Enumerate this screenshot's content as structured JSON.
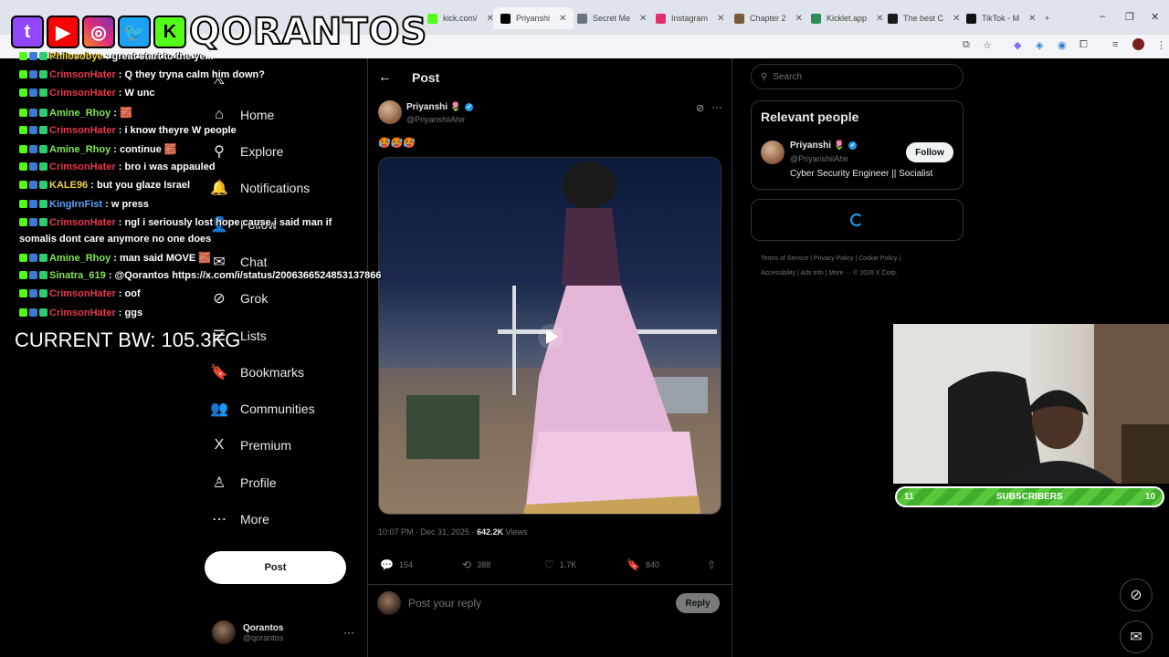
{
  "browser": {
    "tabs": [
      {
        "label": "kick.com/",
        "color": "#53fc18"
      },
      {
        "label": "Priyanshi",
        "color": "#000000"
      },
      {
        "label": "Secret Me",
        "color": "#6b7280"
      },
      {
        "label": "Instagram",
        "color": "#e1306c"
      },
      {
        "label": "Chapter 2",
        "color": "#7a5c3a"
      },
      {
        "label": "Kicklet.app",
        "color": "#2e8b57"
      },
      {
        "label": "The best C",
        "color": "#1a1a1a"
      },
      {
        "label": "TikTok - M",
        "color": "#111111"
      }
    ],
    "new_tab": "+",
    "window_controls": [
      "–",
      "❐",
      "✕"
    ]
  },
  "overlay": {
    "logo_text": "QORANTOS",
    "logo_icons": [
      "twitch",
      "youtube",
      "instagram",
      "twitter",
      "kick"
    ],
    "bw_text": "CURRENT BW: 105.3KG"
  },
  "chat": [
    {
      "user": "Philosobye",
      "msg": "great start to the ye...",
      "color": "u-yellow"
    },
    {
      "user": "CrimsonHater",
      "msg": "Q they tryna calm him down?",
      "color": "u-red"
    },
    {
      "user": "CrimsonHater",
      "msg": "W unc",
      "color": "u-red"
    },
    {
      "user": "Amine_Rhoy",
      "msg": "🧱",
      "color": "u-green"
    },
    {
      "user": "CrimsonHater",
      "msg": "i know theyre W people",
      "color": "u-red"
    },
    {
      "user": "Amine_Rhoy",
      "msg": "continue 🧱",
      "color": "u-green"
    },
    {
      "user": "CrimsonHater",
      "msg": "bro i was appauled",
      "color": "u-red"
    },
    {
      "user": "KALE96",
      "msg": "but you glaze Israel",
      "color": "u-yellow"
    },
    {
      "user": "KingIrnFist",
      "msg": "w press",
      "color": "u-blue"
    },
    {
      "user": "CrimsonHater",
      "msg": "ngl i seriously lost hope cause i said man if",
      "msg2": "somalis dont care anymore no one does",
      "color": "u-red"
    },
    {
      "user": "Amine_Rhoy",
      "msg": "man said MOVE 🧱",
      "color": "u-green"
    },
    {
      "user": "Sinatra_619",
      "msg": "@Qorantos https://x.com/i/status/2006366524853137866",
      "color": "u-green"
    },
    {
      "user": "CrimsonHater",
      "msg": "oof",
      "color": "u-red"
    },
    {
      "user": "CrimsonHater",
      "msg": "ggs",
      "color": "u-red"
    }
  ],
  "sidebar": {
    "items": [
      {
        "label": "Home",
        "icon": "⌂",
        "name": "home"
      },
      {
        "label": "Explore",
        "icon": "⚲",
        "name": "explore"
      },
      {
        "label": "Notifications",
        "icon": "🔔",
        "name": "notifications"
      },
      {
        "label": "Follow",
        "icon": "👤",
        "name": "follow"
      },
      {
        "label": "Chat",
        "icon": "✉",
        "name": "chat"
      },
      {
        "label": "Grok",
        "icon": "⊘",
        "name": "grok"
      },
      {
        "label": "Lists",
        "icon": "☰",
        "name": "lists"
      },
      {
        "label": "Bookmarks",
        "icon": "🔖",
        "name": "bookmarks"
      },
      {
        "label": "Communities",
        "icon": "👥",
        "name": "communities"
      },
      {
        "label": "Premium",
        "icon": "X",
        "name": "premium"
      },
      {
        "label": "Profile",
        "icon": "♙",
        "name": "profile"
      },
      {
        "label": "More",
        "icon": "⋯",
        "name": "more"
      }
    ],
    "post_button": "Post",
    "account": {
      "name": "Qorantos",
      "handle": "@qorantos",
      "menu": "···"
    }
  },
  "post": {
    "back": "←",
    "title": "Post",
    "author_name": "Priyanshi 🌷",
    "author_handle": "@PriyanshiiAhir",
    "text": "🥵🥵🥵",
    "time": "10:07 PM · Dec 31, 2025 · ",
    "views_count": "642.2K",
    "views_label": " Views",
    "stats": {
      "replies": "154",
      "reposts": "388",
      "likes": "1.7K",
      "bookmarks": "840"
    },
    "reply_placeholder": "Post your reply",
    "reply_button": "Reply"
  },
  "right": {
    "search_placeholder": "Search",
    "relevant_title": "Relevant people",
    "person": {
      "name": "Priyanshi 🌷",
      "handle": "@PriyanshiiAhir",
      "bio": "Cyber Security Engineer || Socialist",
      "follow": "Follow"
    },
    "footer1": "Terms of Service  |  Privacy Policy  |  Cookie Policy  |",
    "footer2": "Accessibility  |  Ads info  |  More ···  © 2026 X Corp."
  },
  "subscribers": {
    "left": "11",
    "label": "SUBSCRIBERS",
    "right": "10"
  }
}
